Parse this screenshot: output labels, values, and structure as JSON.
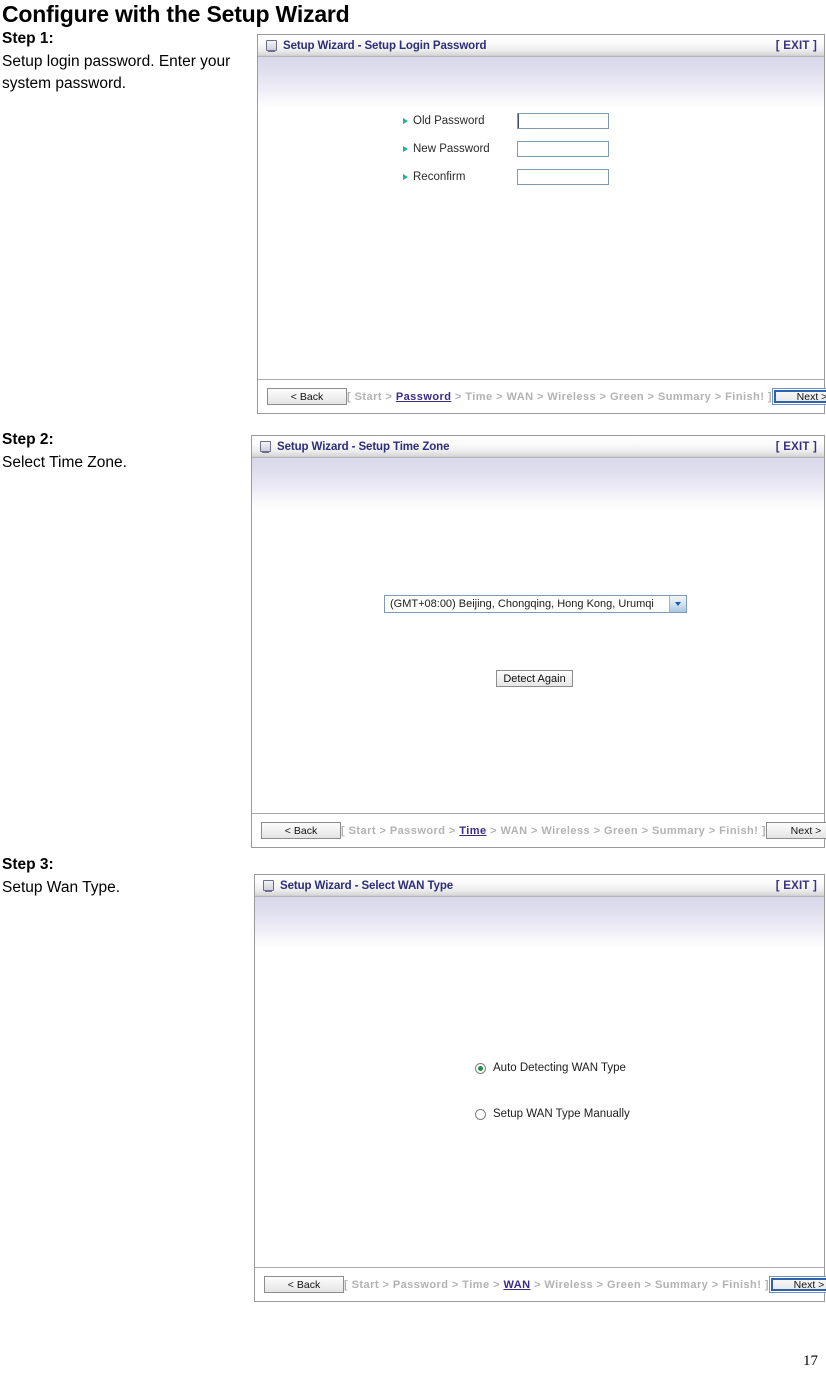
{
  "document": {
    "title": "Configure with the Setup Wizard",
    "page_number": "17"
  },
  "steps": [
    {
      "heading": "Step 1:",
      "description": "Setup login password. Enter your system password."
    },
    {
      "heading": "Step 2:",
      "description": "Select Time Zone."
    },
    {
      "heading": "Step 3:",
      "description": "Setup Wan Type."
    }
  ],
  "panels": [
    {
      "title": "Setup Wizard - Setup Login Password",
      "exit_label": "[ EXIT ]",
      "title_icon": "window-icon",
      "fields": [
        {
          "label": "Old Password",
          "value": "",
          "focused": true
        },
        {
          "label": "New Password",
          "value": "",
          "focused": false
        },
        {
          "label": "Reconfirm",
          "value": "",
          "focused": false
        }
      ],
      "nav": {
        "back_label": "< Back",
        "next_label": "Next >",
        "next_focused": true,
        "crumb_open": "[",
        "crumb_close": "]",
        "crumbs": [
          {
            "label": "Start",
            "active": false
          },
          {
            "label": "Password",
            "active": true
          },
          {
            "label": "Time",
            "active": false
          },
          {
            "label": "WAN",
            "active": false
          },
          {
            "label": "Wireless",
            "active": false
          },
          {
            "label": "Green",
            "active": false
          },
          {
            "label": "Summary",
            "active": false
          },
          {
            "label": "Finish!",
            "active": false
          }
        ],
        "separator": ">"
      }
    },
    {
      "title": "Setup Wizard - Setup Time Zone",
      "exit_label": "[ EXIT ]",
      "title_icon": "window-icon",
      "timezone": {
        "selected": "(GMT+08:00) Beijing, Chongqing, Hong Kong, Urumqi",
        "arrow_icon": "chevron-down-icon"
      },
      "detect_button": "Detect Again",
      "nav": {
        "back_label": "< Back",
        "next_label": "Next >",
        "next_focused": false,
        "crumb_open": "[",
        "crumb_close": "]",
        "crumbs": [
          {
            "label": "Start",
            "active": false
          },
          {
            "label": "Password",
            "active": false
          },
          {
            "label": "Time",
            "active": true
          },
          {
            "label": "WAN",
            "active": false
          },
          {
            "label": "Wireless",
            "active": false
          },
          {
            "label": "Green",
            "active": false
          },
          {
            "label": "Summary",
            "active": false
          },
          {
            "label": "Finish!",
            "active": false
          }
        ],
        "separator": ">"
      }
    },
    {
      "title": "Setup Wizard - Select WAN Type",
      "exit_label": "[ EXIT ]",
      "title_icon": "window-icon",
      "wan_options": [
        {
          "label": "Auto Detecting WAN Type",
          "checked": true
        },
        {
          "label": "Setup WAN Type Manually",
          "checked": false
        }
      ],
      "nav": {
        "back_label": "< Back",
        "next_label": "Next >",
        "next_focused": true,
        "crumb_open": "[",
        "crumb_close": "]",
        "crumbs": [
          {
            "label": "Start",
            "active": false
          },
          {
            "label": "Password",
            "active": false
          },
          {
            "label": "Time",
            "active": false
          },
          {
            "label": "WAN",
            "active": true
          },
          {
            "label": "Wireless",
            "active": false
          },
          {
            "label": "Green",
            "active": false
          },
          {
            "label": "Summary",
            "active": false
          },
          {
            "label": "Finish!",
            "active": false
          }
        ],
        "separator": ">"
      }
    }
  ],
  "colors": {
    "panel_title": "#2d2d7a",
    "exit_link": "#3b2f87",
    "crumb_inactive": "#b2b2b2",
    "crumb_active": "#3c2a86",
    "bullet": "#19b39b",
    "radio_selected": "#1f8f46",
    "panel_gradient_top": "#d9d8ec"
  }
}
